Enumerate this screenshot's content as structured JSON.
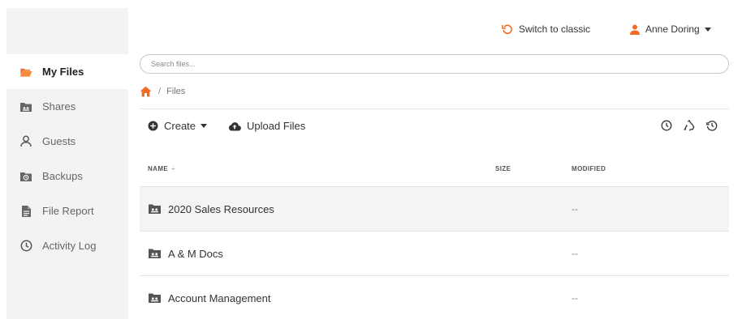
{
  "sidebar": {
    "items": [
      {
        "label": "My Files",
        "icon": "folder-open-icon",
        "active": true
      },
      {
        "label": "Shares",
        "icon": "shared-folder-icon"
      },
      {
        "label": "Guests",
        "icon": "user-icon"
      },
      {
        "label": "Backups",
        "icon": "backup-folder-icon"
      },
      {
        "label": "File Report",
        "icon": "file-report-icon"
      },
      {
        "label": "Activity Log",
        "icon": "clock-icon"
      }
    ]
  },
  "header": {
    "switch_label": "Switch to classic",
    "user_name": "Anne Doring"
  },
  "search": {
    "placeholder": "Search files..."
  },
  "breadcrumb": {
    "separator": "/",
    "current": "Files"
  },
  "toolbar": {
    "create_label": "Create",
    "upload_label": "Upload Files"
  },
  "table": {
    "columns": {
      "name": "NAME",
      "sort_indicator": "÷",
      "size": "SIZE",
      "modified": "MODIFIED"
    },
    "rows": [
      {
        "name": "2020 Sales Resources",
        "size": "",
        "modified": "--"
      },
      {
        "name": "A & M Docs",
        "size": "",
        "modified": "--"
      },
      {
        "name": "Account Management",
        "size": "",
        "modified": "--"
      }
    ]
  },
  "colors": {
    "accent": "#f26b22",
    "sidebar_bg": "#f3f3f3",
    "row_highlight": "#f3f4f6"
  }
}
